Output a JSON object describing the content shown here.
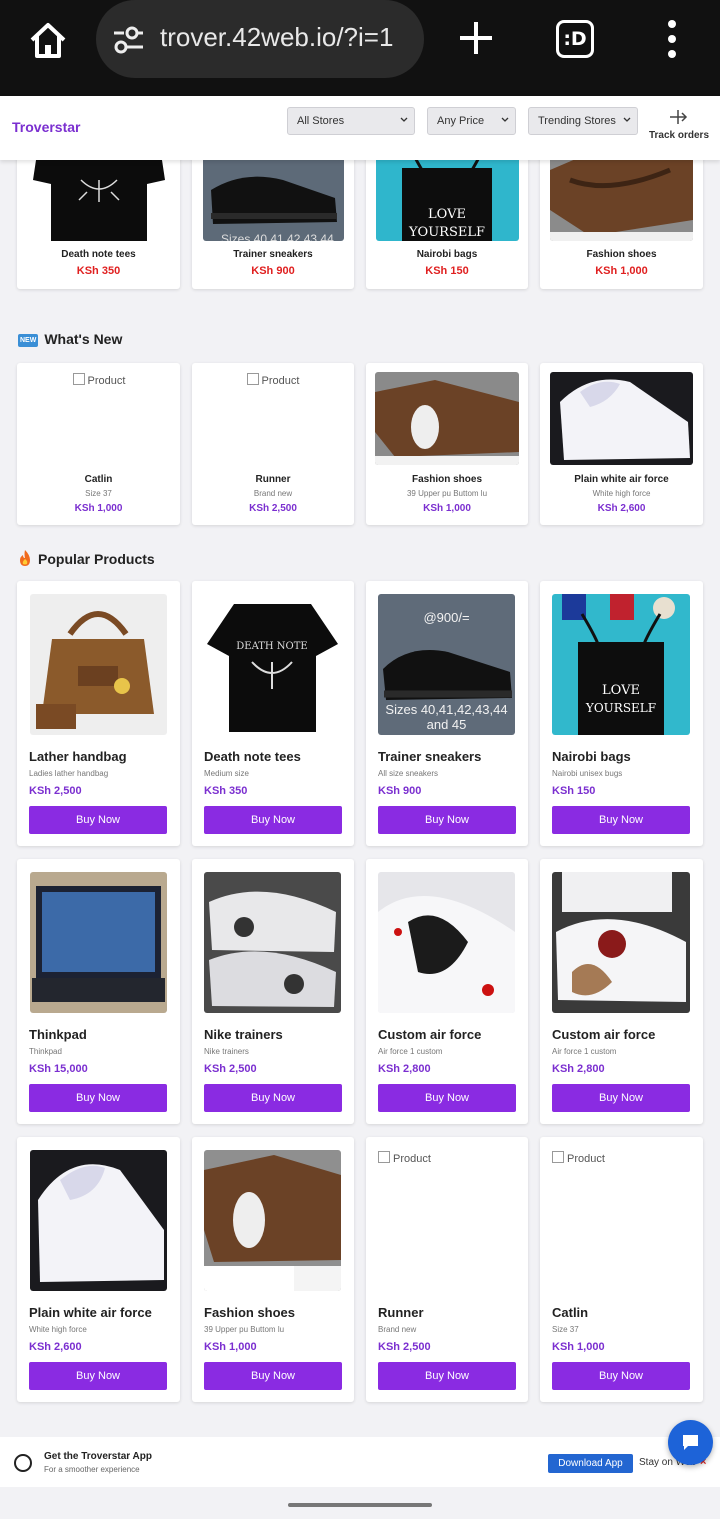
{
  "browser": {
    "url": "trover.42web.io/?i=1",
    "tabs_label": ":D"
  },
  "header": {
    "brand": "Troverstar",
    "filters": {
      "store": "All Stores",
      "price": "Any Price",
      "sort": "Trending Stores"
    },
    "track_label": "Track orders"
  },
  "trending": [
    {
      "name": "Death note tees",
      "price": "KSh 350"
    },
    {
      "name": "Trainer sneakers",
      "price": "KSh 900"
    },
    {
      "name": "Nairobi bags",
      "price": "KSh 150"
    },
    {
      "name": "Fashion shoes",
      "price": "KSh 1,000"
    }
  ],
  "trending_overlay": {
    "sneaker_text": "Sizes 40,41,42,43,44"
  },
  "whats_new": {
    "badge": "NEW",
    "title": "What's New",
    "items": [
      {
        "name": "Catlin",
        "sub": "Size 37",
        "price": "KSh 1,000",
        "alt": "Product"
      },
      {
        "name": "Runner",
        "sub": "Brand new",
        "price": "KSh 2,500",
        "alt": "Product"
      },
      {
        "name": "Fashion shoes",
        "sub": "39 Upper pu Buttom lu",
        "price": "KSh 1,000"
      },
      {
        "name": "Plain white air force",
        "sub": "White high force",
        "price": "KSh 2,600"
      }
    ]
  },
  "popular": {
    "title": "Popular Products",
    "buy_label": "Buy Now",
    "items": [
      {
        "name": "Lather handbag",
        "sub": "Ladies lather handbag",
        "price": "KSh 2,500"
      },
      {
        "name": "Death note tees",
        "sub": "Medium size",
        "price": "KSh 350"
      },
      {
        "name": "Trainer sneakers",
        "sub": "All size sneakers",
        "price": "KSh 900"
      },
      {
        "name": "Nairobi bags",
        "sub": "Nairobi unisex bugs",
        "price": "KSh 150"
      },
      {
        "name": "Thinkpad",
        "sub": "Thinkpad",
        "price": "KSh 15,000"
      },
      {
        "name": "Nike trainers",
        "sub": "Nike trainers",
        "price": "KSh 2,500"
      },
      {
        "name": "Custom air force",
        "sub": "Air force 1 custom",
        "price": "KSh 2,800"
      },
      {
        "name": "Custom air force",
        "sub": "Air force 1 custom",
        "price": "KSh 2,800"
      },
      {
        "name": "Plain white air force",
        "sub": "White high force",
        "price": "KSh 2,600"
      },
      {
        "name": "Fashion shoes",
        "sub": "39 Upper pu Buttom lu",
        "price": "KSh 1,000"
      },
      {
        "name": "Runner",
        "sub": "Brand new",
        "price": "KSh 2,500",
        "alt": "Product"
      },
      {
        "name": "Catlin",
        "sub": "Size 37",
        "price": "KSh 1,000",
        "alt": "Product"
      }
    ],
    "sneaker_price_text": "@900/=",
    "sneaker_sizes_text": "Sizes 40,41,42,43,44 and 45",
    "bag_text_1": "LOVE",
    "bag_text_2": "YOURSELF",
    "tee_text": "DEATH NOTE"
  },
  "banner": {
    "title": "Get the Troverstar App",
    "subtitle": "For a smoother experience",
    "download": "Download App",
    "stay": "Stay on Web",
    "close": "×"
  },
  "colors": {
    "accent": "#8a2be2",
    "price_red": "#e02020",
    "brand": "#7b2fd0"
  }
}
